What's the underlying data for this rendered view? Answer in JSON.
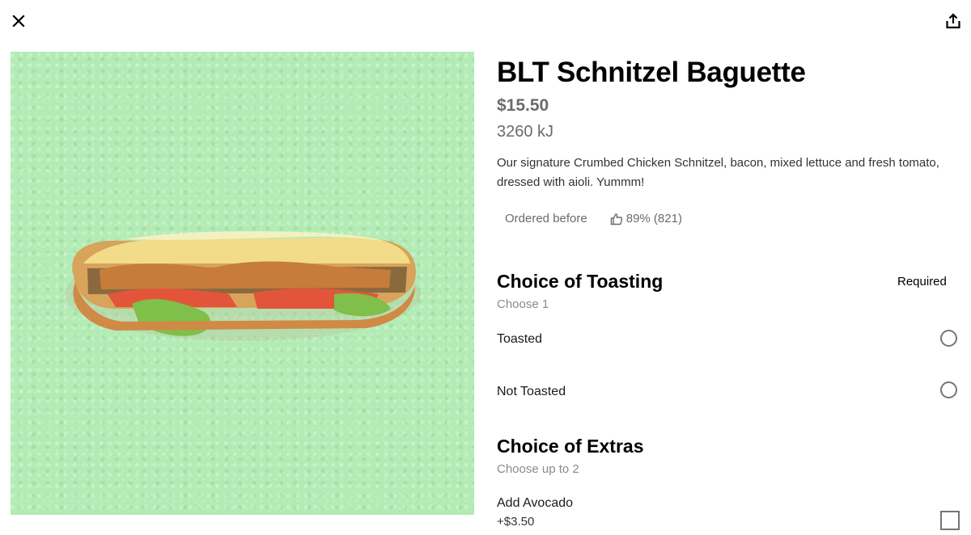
{
  "icons": {
    "close": "close-icon",
    "share": "share-icon",
    "thumbs_up": "thumbs-up-icon"
  },
  "product": {
    "title": "BLT Schnitzel Baguette",
    "price": "$15.50",
    "energy": "3260 kJ",
    "description": "Our signature Crumbed Chicken Schnitzel, bacon, mixed lettuce and fresh tomato, dressed with aioli. Yummm!",
    "ordered_before": "Ordered before",
    "rating": "89% (821)"
  },
  "toasting": {
    "title": "Choice of Toasting",
    "required": "Required",
    "subtitle": "Choose 1",
    "options": [
      {
        "label": "Toasted",
        "selected": false
      },
      {
        "label": "Not Toasted",
        "selected": false
      }
    ]
  },
  "extras": {
    "title": "Choice of Extras",
    "subtitle": "Choose up to 2",
    "options": [
      {
        "label": "Add Avocado",
        "price": "+$3.50",
        "checked": false
      }
    ]
  },
  "colors": {
    "image_background": "#b2ebb4",
    "muted_text": "#6b6b6b",
    "control_border": "#757575"
  }
}
